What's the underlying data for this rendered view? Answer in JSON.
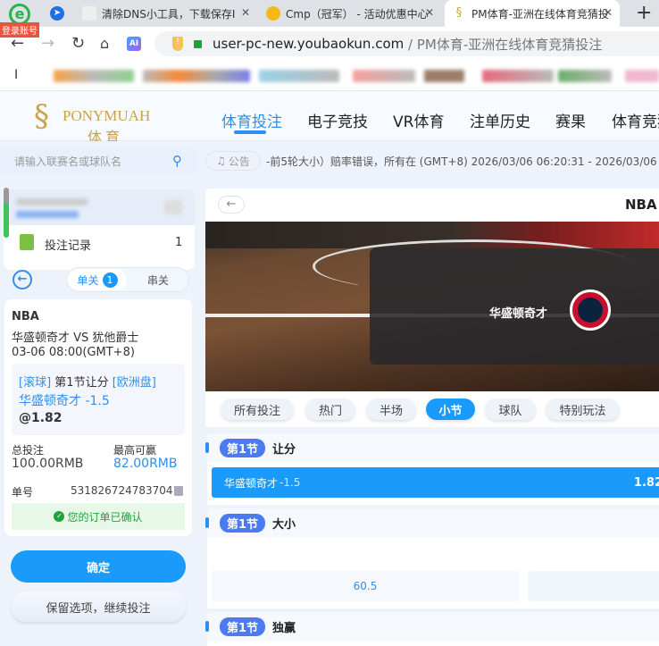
{
  "browser": {
    "login_badge": "登录账号",
    "tabs": [
      {
        "title": "清除DNS小工具，下载保存I",
        "favicon": "tool-icon"
      },
      {
        "title": "Cmp（冠军） - 活动优惠中心",
        "favicon": "c-coin-icon"
      },
      {
        "title": "PM体育-亚洲在线体育竞猜投",
        "favicon": "ponymuah-logo-icon",
        "active": true
      }
    ],
    "url_domain": "user-pc-new.youbaokun.com",
    "url_title": " / PM体育-亚洲在线体育竞猜投注",
    "ai_label": "AI"
  },
  "site": {
    "logo_text": "PONYMUAH",
    "logo_sub": "体育",
    "nav": [
      "体育投注",
      "电子竞技",
      "VR体育",
      "注单历史",
      "赛果",
      "体育竞猜"
    ],
    "active_nav": 0,
    "accent": "#1a9bfc"
  },
  "sidebar": {
    "search_placeholder": "请输入联赛名或球队名",
    "bet_record_label": "投注记录",
    "bet_record_count": "1",
    "tab_single": "单关",
    "tab_single_count": "1",
    "tab_parlay": "串关",
    "bet": {
      "league": "NBA",
      "match": "华盛顿奇才 VS 犹他爵士",
      "time": "03-06 08:00(GMT+8)",
      "tag_live": "[滚球]",
      "market": "第1节让分",
      "tag_odds_type": "[欧洲盘]",
      "selection": "华盛顿奇才 -1.5",
      "odds": "@1.82",
      "stake_label": "总投注",
      "stake": "100.00RMB",
      "max_win_label": "最高可赢",
      "max_win": "82.00RMB",
      "order_label": "单号",
      "order_no": "5318267247837041",
      "status": "您的订单已确认"
    },
    "confirm_button": "确定",
    "keep_button": "保留选项，继续投注"
  },
  "main": {
    "notice_label": "公告",
    "notice_text": "-前5轮大小）赔率错误，所有在 (GMT+8) 2026/03/06 06:20:31 - 2026/03/06 0",
    "league": "NBA",
    "home_team": "华盛顿奇才",
    "filters": [
      "所有投注",
      "热门",
      "半场",
      "小节",
      "球队",
      "特别玩法"
    ],
    "active_filter": 3,
    "sections": [
      {
        "badge": "第1节",
        "title": "让分",
        "selection": "华盛顿奇才",
        "line": "-1.5",
        "odds": "1.82"
      },
      {
        "badge": "第1节",
        "title": "大小",
        "line": "60.5"
      },
      {
        "badge": "第1节",
        "title": "独赢"
      }
    ]
  }
}
